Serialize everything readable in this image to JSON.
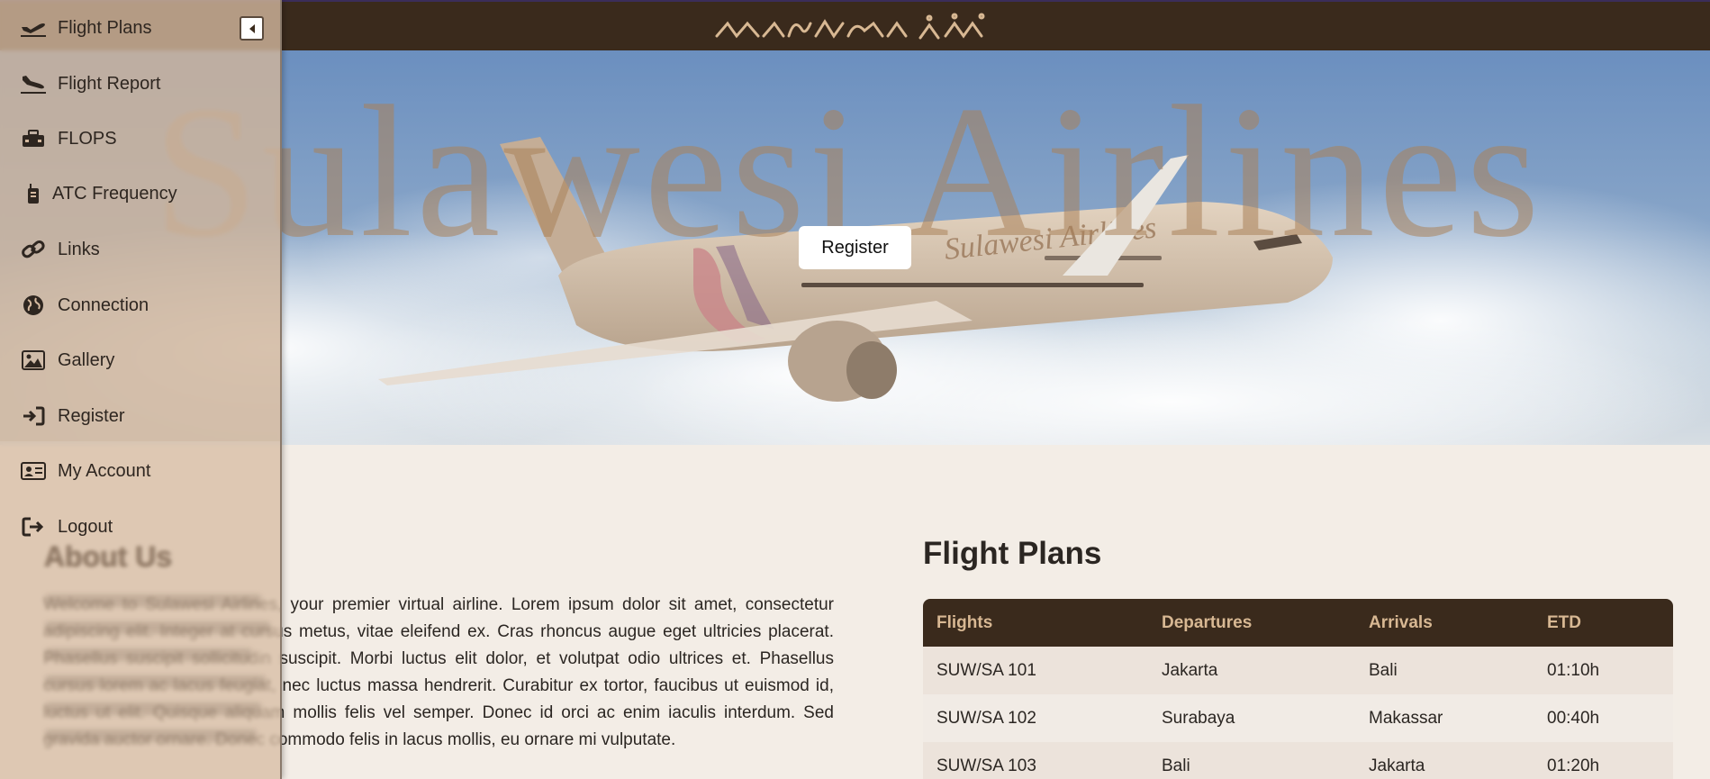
{
  "header": {
    "logo_icon": "aksara-script-logo"
  },
  "hero": {
    "title": "Sulawesi Airlines",
    "register_label": "Register",
    "aircraft_livery_text": "Sulawesi Airlines"
  },
  "sidebar": {
    "collapse_icon": "caret-left-icon",
    "items": [
      {
        "label": "Flight Plans",
        "icon": "plane-departure-icon"
      },
      {
        "label": "Flight Report",
        "icon": "plane-arrival-icon"
      },
      {
        "label": "FLOPS",
        "icon": "toolbox-icon"
      },
      {
        "label": "ATC Frequency",
        "icon": "walkie-talkie-icon"
      },
      {
        "label": "Links",
        "icon": "link-icon"
      },
      {
        "label": "Connection",
        "icon": "globe-icon"
      },
      {
        "label": "Gallery",
        "icon": "image-icon"
      },
      {
        "label": "Register",
        "icon": "sign-in-icon"
      },
      {
        "label": "My Account",
        "icon": "id-card-icon"
      },
      {
        "label": "Logout",
        "icon": "sign-out-icon"
      }
    ]
  },
  "about": {
    "title": "About Us",
    "text": "Welcome to Sulawesi Airlines, your premier virtual airline. Lorem ipsum dolor sit amet, consectetur adipiscing elit. Integer at cursus metus, vitae eleifend ex. Cras rhoncus augue eget ultricies placerat. Phasellus suscipit sollicitudin suscipit. Morbi luctus elit dolor, et volutpat odio ultrices et. Phasellus cursus lorem ac lacus feugiat, nec luctus massa hendrerit. Curabitur ex tortor, faucibus ut euismod id, luctus ut elit. Quisque aliquam mollis felis vel semper. Donec id orci ac enim iaculis interdum. Sed gravida auctor ornare. Donec commodo felis in lacus mollis, eu ornare mi vulputate."
  },
  "flight_plans": {
    "title": "Flight Plans",
    "columns": [
      "Flights",
      "Departures",
      "Arrivals",
      "ETD"
    ],
    "rows": [
      [
        "SUW/SA 101",
        "Jakarta",
        "Bali",
        "01:10h"
      ],
      [
        "SUW/SA 102",
        "Surabaya",
        "Makassar",
        "00:40h"
      ],
      [
        "SUW/SA 103",
        "Bali",
        "Jakarta",
        "01:20h"
      ]
    ]
  },
  "colors": {
    "brand_dark": "#3a2a1c",
    "table_header_text": "#d8b893",
    "page_bg": "#f3ede6",
    "sidebar_overlay": "#d6baa0"
  }
}
